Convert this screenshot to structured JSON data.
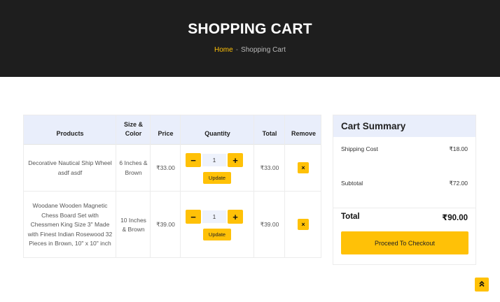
{
  "header": {
    "title": "SHOPPING CART",
    "breadcrumb": {
      "home": "Home",
      "separator": "-",
      "current": "Shopping Cart"
    }
  },
  "cart": {
    "columns": [
      "Products",
      "Size & Color",
      "Price",
      "Quantity",
      "Total",
      "Remove"
    ],
    "rows": [
      {
        "product": "Decorative Nautical Ship Wheel asdf asdf",
        "size_color": "6 Inches & Brown",
        "price": "₹33.00",
        "quantity": "1",
        "total": "₹33.00"
      },
      {
        "product": "Woodane Wooden Magnetic Chess Board Set with Chessmen King Size 3\" Made with Finest Indian Rosewood 32 Pieces in Brown, 10\" x 10\" inch",
        "size_color": "10 Inches & Brown",
        "price": "₹39.00",
        "quantity": "1",
        "total": "₹39.00"
      }
    ],
    "minus_label": "−",
    "plus_label": "+",
    "update_label": "Update",
    "remove_label": "×"
  },
  "summary": {
    "title": "Cart Summary",
    "shipping_label": "Shipping Cost",
    "shipping_value": "₹18.00",
    "subtotal_label": "Subtotal",
    "subtotal_value": "₹72.00",
    "total_label": "Total",
    "total_value": "₹90.00",
    "checkout_label": "Proceed To Checkout"
  },
  "scroll_top": {
    "icon": "double-chevron-up-icon",
    "label": "»"
  },
  "colors": {
    "accent": "#ffc107",
    "hero_bg": "#1e1e1e",
    "table_head": "#e9eefb"
  }
}
